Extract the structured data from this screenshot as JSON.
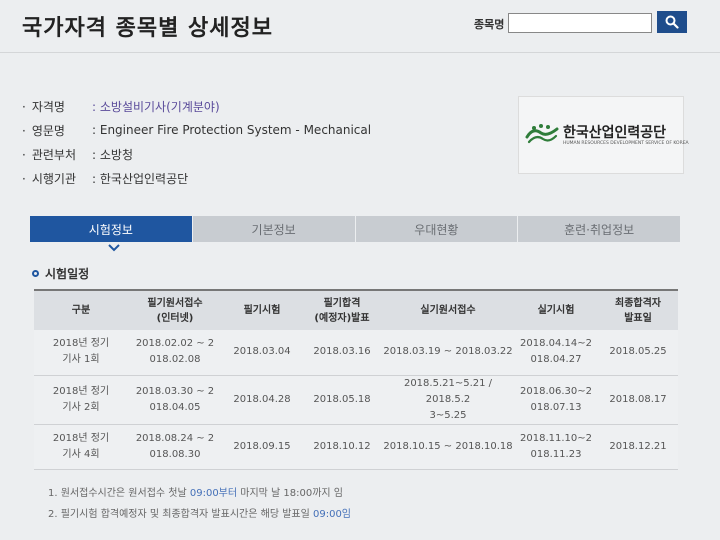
{
  "header": {
    "title": "국가자격 종목별 상세정보",
    "search_label": "종목명",
    "search_value": "",
    "search_placeholder": ""
  },
  "info": [
    {
      "key": "자격명",
      "value": ": 소방설비기사(기계분야)"
    },
    {
      "key": "영문명",
      "value": ": Engineer Fire Protection System - Mechanical"
    },
    {
      "key": "관련부처",
      "value": ": 소방청"
    },
    {
      "key": "시행기관",
      "value": ": 한국산업인력공단"
    }
  ],
  "logo": {
    "name_kr": "한국산업인력공단",
    "name_en": "HUMAN RESOURCES DEVELOPMENT SERVICE OF KOREA"
  },
  "tabs": [
    {
      "label": "시험정보",
      "active": true
    },
    {
      "label": "기본정보",
      "active": false
    },
    {
      "label": "우대현황",
      "active": false
    },
    {
      "label": "훈련·취업정보",
      "active": false
    }
  ],
  "section": {
    "title": "시험일정"
  },
  "table": {
    "headers": [
      "구분",
      "필기원서접수\n(인터넷)",
      "필기시험",
      "필기합격\n(예정자)발표",
      "실기원서접수",
      "실기시험",
      "최종합격자\n발표일"
    ],
    "rows": [
      [
        "2018년 정기\n기사 1회",
        "2018.02.02 ~ 2\n018.02.08",
        "2018.03.04",
        "2018.03.16",
        "2018.03.19 ~ 2018.03.22",
        "2018.04.14~2\n018.04.27",
        "2018.05.25"
      ],
      [
        "2018년 정기\n기사 2회",
        "2018.03.30 ~ 2\n018.04.05",
        "2018.04.28",
        "2018.05.18",
        "2018.5.21~5.21 / 2018.5.2\n3~5.25",
        "2018.06.30~2\n018.07.13",
        "2018.08.17"
      ],
      [
        "2018년 정기\n기사 4회",
        "2018.08.24 ~ 2\n018.08.30",
        "2018.09.15",
        "2018.10.12",
        "2018.10.15 ~ 2018.10.18",
        "2018.11.10~2\n018.11.23",
        "2018.12.21"
      ]
    ]
  },
  "notes": [
    {
      "before": "1. 원서접수시간은 원서접수 첫날 ",
      "highlight": "09:00부터",
      "after": " 마지막 날 18:00까지 임"
    },
    {
      "before": "2. 필기시험 합격예정자 및 최종합격자 발표시간은 해당 발표일 ",
      "highlight": "09:00임",
      "after": ""
    }
  ],
  "colors": {
    "accent": "#1f56a0",
    "search_button": "#1f4d8c",
    "tab_inactive": "#c8ccd1",
    "highlight": "#4470b8"
  },
  "icons": {
    "search": "search-icon",
    "tab_indicator": "chevron-down-icon",
    "section_bullet": "circle-bullet-icon",
    "logo": "hrdk-logo-icon"
  }
}
